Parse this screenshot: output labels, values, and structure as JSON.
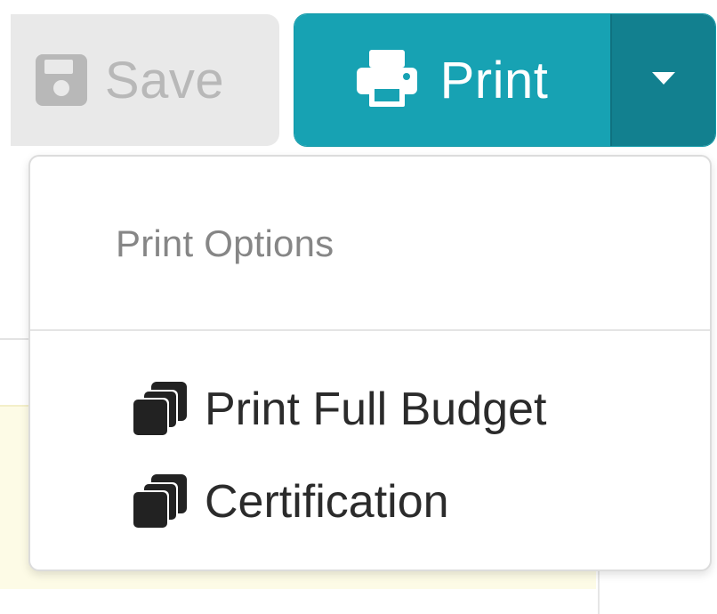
{
  "toolbar": {
    "save": {
      "label": "Save",
      "icon": "floppy-disk-icon",
      "disabled": true
    },
    "print": {
      "label": "Print",
      "icon": "printer-icon",
      "toggle_icon": "caret-down-icon"
    }
  },
  "dropdown": {
    "header": "Print Options",
    "items": [
      {
        "label": "Print Full Budget",
        "icon": "copy-icon"
      },
      {
        "label": "Certification",
        "icon": "copy-icon"
      }
    ]
  },
  "colors": {
    "print_primary": "#17a2b3",
    "print_toggle": "#12808f",
    "save_disabled_bg": "#e9e9e9",
    "save_disabled_text": "#b8b8b8",
    "menu_text": "#2b2b2b",
    "menu_header_text": "#868686",
    "background_highlight": "#fdfbe6"
  }
}
